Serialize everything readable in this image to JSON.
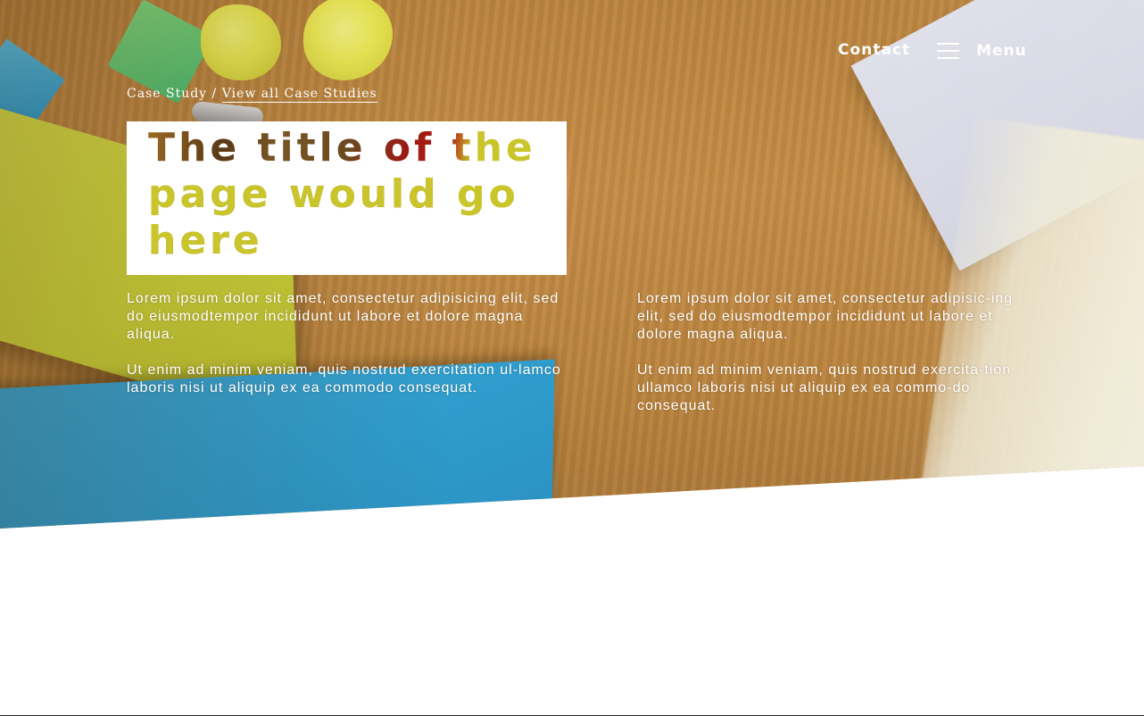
{
  "nav": {
    "contact_label": "Contact",
    "menu_label": "Menu"
  },
  "breadcrumb": {
    "current": "Case Study",
    "separator": " / ",
    "link_label": "View all Case Studies"
  },
  "title": {
    "line1": "The title of the",
    "line2": "page would go",
    "line3": "here"
  },
  "columns": {
    "left": [
      "Lorem ipsum dolor sit amet, consectetur adipisicing elit, sed do eiusmodtempor incididunt ut labore et dolore magna aliqua.",
      "Ut enim ad minim veniam, quis nostrud exercitation ul-lamco laboris nisi ut aliquip ex ea commodo consequat."
    ],
    "right": [
      "Lorem ipsum dolor sit amet, consectetur adipisic-ing elit, sed do eiusmodtempor incididunt ut labore et dolore magna aliqua.",
      "Ut enim ad minim veniam, quis nostrud exercita-tion ullamco laboris nisi ut aliquip ex ea commo-do consequat."
    ]
  },
  "colors": {
    "title_accent": "#c9c52a",
    "title_box_bg": "#ffffff",
    "text_on_image": "#ffffff"
  },
  "icons": {
    "menu": "hamburger-icon"
  }
}
